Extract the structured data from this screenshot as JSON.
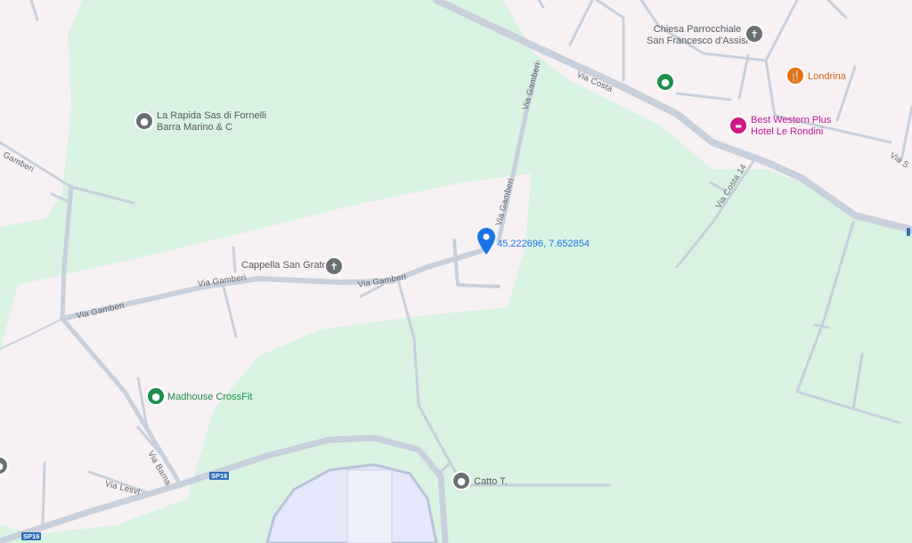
{
  "colors": {
    "park": "#d9f3e2",
    "urban": "#f7f1f4",
    "road": "#c7d0dc",
    "road_edge": "#b4bfcc",
    "water_blue": "#e4e8fa",
    "pin_blue": "#1a73e8",
    "poi_gray": "#6b7075",
    "poi_green": "#1e8e4a",
    "poi_orange": "#e8710a",
    "poi_pink": "#d01884"
  },
  "pois": {
    "la_rapida": {
      "line1": "La Rapida Sas di Fornelli",
      "line2": "Barra Marino & C",
      "icon": "pin-gray-icon"
    },
    "chiesa": {
      "line1": "Chiesa Parrocchiale",
      "line2": "San Francesco d'Assisi",
      "icon": "cross-icon"
    },
    "londrina": {
      "label": "Londrina",
      "icon": "restaurant-icon"
    },
    "best_western": {
      "line1": "Best Western Plus",
      "line2": "Hotel Le Rondini",
      "icon": "hotel-icon"
    },
    "cappella": {
      "label": "Cappella San Grato",
      "icon": "cross-icon"
    },
    "madhouse": {
      "label": "Madhouse CrossFit",
      "icon": "gym-icon"
    },
    "catto": {
      "label": "Catto T.",
      "icon": "pin-gray-icon"
    }
  },
  "dropped_pin": {
    "coords": "45.222696, 7.652854",
    "icon": "location-pin-icon"
  },
  "roads": {
    "via_costa": "Via Costa",
    "via_costa_14": "Via Costa 14",
    "via_gamberi": "Via Gamberi",
    "via_bama": "Via Bama",
    "via_leavi": "Via Lesvi",
    "gamberi_short": "Gamberi",
    "via_s": "Via S",
    "sp16": "SP16"
  }
}
